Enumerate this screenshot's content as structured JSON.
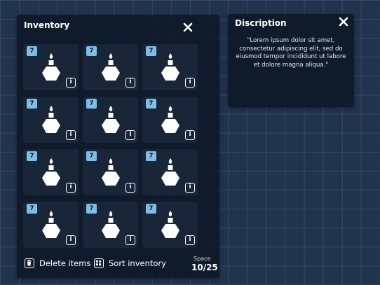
{
  "inventory": {
    "title": "Inventory",
    "slots": [
      {
        "count": "7",
        "item": "potion-icon"
      },
      {
        "count": "7",
        "item": "potion-icon"
      },
      {
        "count": "7",
        "item": "potion-icon"
      },
      {
        "count": "7",
        "item": "potion-icon"
      },
      {
        "count": "7",
        "item": "potion-icon"
      },
      {
        "count": "7",
        "item": "potion-icon"
      },
      {
        "count": "7",
        "item": "potion-icon"
      },
      {
        "count": "7",
        "item": "potion-icon"
      },
      {
        "count": "7",
        "item": "potion-icon"
      },
      {
        "count": "7",
        "item": "potion-icon"
      },
      {
        "count": "7",
        "item": "potion-icon"
      },
      {
        "count": "7",
        "item": "potion-icon"
      }
    ],
    "info_label": "i",
    "delete_label": "Delete items",
    "sort_label": "Sort inventory",
    "space_label": "Space",
    "space_value": "10/25"
  },
  "description": {
    "title": "Discription",
    "text": "\"Lorem ipsum dolor sit amet, consectetur adipiscing elit, sed do eiusmod tempor incididunt ut labore et dolore magna aliqua.\""
  },
  "colors": {
    "background": "#22334d",
    "panel": "#0e1828",
    "slot": "#182638",
    "badge": "#7fbde6"
  }
}
